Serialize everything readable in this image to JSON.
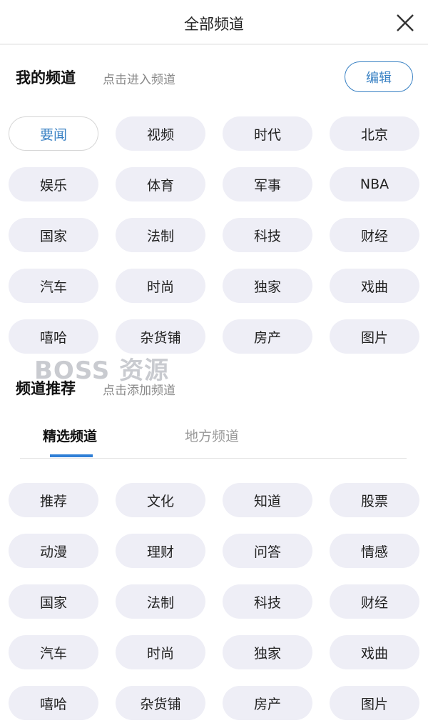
{
  "header": {
    "title": "全部频道",
    "close_icon": "close-x-icon"
  },
  "my_channels": {
    "title": "我的频道",
    "hint": "点击进入频道",
    "edit_label": "编辑",
    "items": [
      "要闻",
      "视频",
      "时代",
      "北京",
      "娱乐",
      "体育",
      "军事",
      "NBA",
      "国家",
      "法制",
      "科技",
      "财经",
      "汽车",
      "时尚",
      "独家",
      "戏曲",
      "嘻哈",
      "杂货铺",
      "房产",
      "图片"
    ],
    "active_index": 0
  },
  "watermark": "BOSS 资源",
  "recommend": {
    "title": "频道推荐",
    "hint": "点击添加频道",
    "tabs": [
      {
        "label": "精选频道",
        "active": true
      },
      {
        "label": "地方频道",
        "active": false
      }
    ],
    "items": [
      "推荐",
      "文化",
      "知道",
      "股票",
      "动漫",
      "理财",
      "问答",
      "情感",
      "国家",
      "法制",
      "科技",
      "财经",
      "汽车",
      "时尚",
      "独家",
      "戏曲",
      "嘻哈",
      "杂货铺",
      "房产",
      "图片"
    ]
  },
  "colors": {
    "accent": "#3a82c4",
    "chip_bg": "#eeeef6",
    "tab_indicator": "#2f7fd6"
  }
}
